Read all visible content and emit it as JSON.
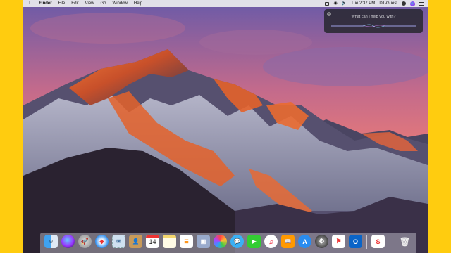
{
  "menubar": {
    "apple": "",
    "app_name": "Finder",
    "menus": [
      "File",
      "Edit",
      "View",
      "Go",
      "Window",
      "Help"
    ],
    "clock": "Tue 2:37 PM",
    "user": "DT-Guest"
  },
  "siri": {
    "prompt": "What can I help you with?"
  },
  "dock": {
    "calendar_day": "14",
    "icons": [
      "finder-icon",
      "siri-icon",
      "launchpad-icon",
      "safari-icon",
      "mail-stamp-icon",
      "contacts-icon",
      "calendar-icon",
      "notes-icon",
      "reminders-icon",
      "preview-icon",
      "photos-icon",
      "messages-icon",
      "facetime-icon",
      "itunes-icon",
      "ibooks-icon",
      "app-store-icon",
      "system-preferences-icon",
      "flag-app-icon",
      "outlook-icon",
      "sketch-app-icon",
      "trash-icon"
    ]
  },
  "colors": {
    "frame": "#FFCC0F",
    "sky_top": "#5a4fa0",
    "sky_pink": "#e8707a",
    "rock_orange": "#e4622a"
  }
}
